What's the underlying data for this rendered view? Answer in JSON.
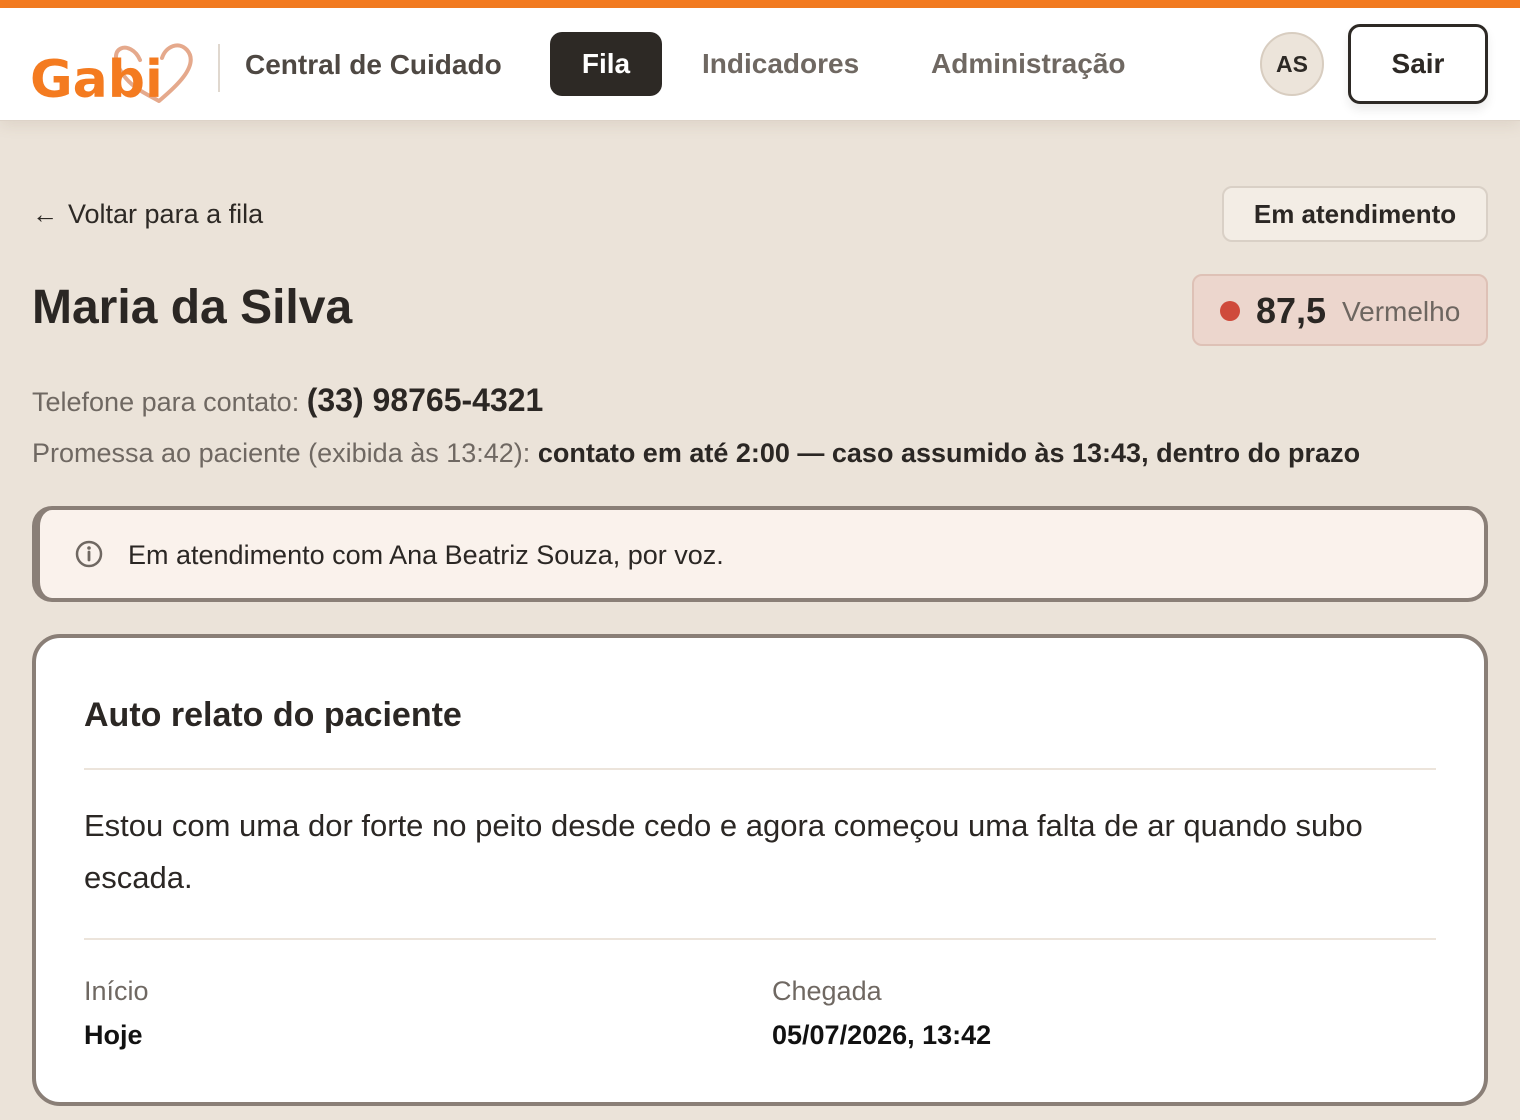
{
  "brand": {
    "logo_text": "Gabi",
    "accent_color": "#f47b20",
    "dark_color": "#2d2925",
    "risk_color": "#cf4a3b"
  },
  "header": {
    "app_title": "Central de Cuidado",
    "nav": [
      {
        "label": "Fila",
        "active": true
      },
      {
        "label": "Indicadores",
        "active": false
      },
      {
        "label": "Administração",
        "active": false
      }
    ],
    "avatar_initials": "AS",
    "logout_label": "Sair"
  },
  "page": {
    "back_arrow": "←",
    "back_label": "Voltar para a fila",
    "status": "Em atendimento",
    "patient_name": "Maria da Silva",
    "risk": {
      "score": "87,5",
      "label": "Vermelho",
      "icon": "red-dot-icon"
    },
    "phone_label": "Telefone para contato:",
    "phone_value": "(33) 98765-4321",
    "promise_label": "Promessa ao paciente (exibida às 13:42):",
    "promise_value": "contato em até 2:00 — caso assumido às 13:43, dentro do prazo"
  },
  "alert": {
    "icon": "info-icon",
    "text": "Em atendimento com Ana Beatriz Souza, por voz."
  },
  "report": {
    "title": "Auto relato do paciente",
    "body": "Estou com uma dor forte no peito desde cedo e agora começou uma falta de ar quando subo escada.",
    "meta": [
      {
        "label": "Início",
        "value": "Hoje"
      },
      {
        "label": "Chegada",
        "value": "05/07/2026, 13:42"
      }
    ]
  }
}
